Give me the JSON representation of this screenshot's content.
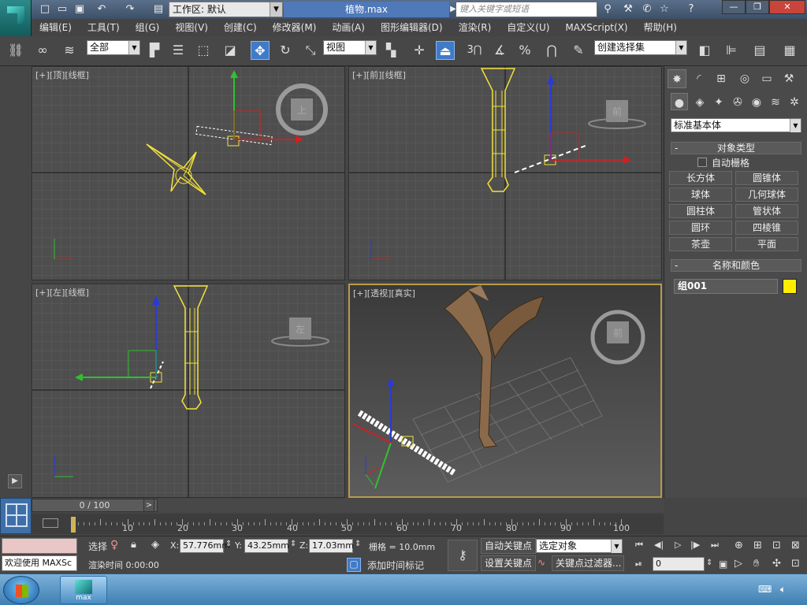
{
  "titlebar": {
    "workspace": "工作区: 默认",
    "filename": "植物.max",
    "search_placeholder": "键入关键字或短语"
  },
  "menu": [
    "编辑(E)",
    "工具(T)",
    "组(G)",
    "视图(V)",
    "创建(C)",
    "修改器(M)",
    "动画(A)",
    "图形编辑器(D)",
    "渲染(R)",
    "自定义(U)",
    "MAXScript(X)",
    "帮助(H)"
  ],
  "toolbar": {
    "selection_filter": "全部",
    "ref_coord": "视图",
    "named_selection": "创建选择集",
    "snap_label": "3"
  },
  "viewports": {
    "top": "[+][顶][线框]",
    "front": "[+][前][线框]",
    "left": "[+][左][线框]",
    "persp": "[+][透视][真实]"
  },
  "viewcube": {
    "top": "上",
    "front": "前",
    "left": "左",
    "persp": "前"
  },
  "cmdpanel": {
    "category": "标准基本体",
    "rollout_object_type": "对象类型",
    "autogrid": "自动栅格",
    "buttons": [
      "长方体",
      "圆锥体",
      "球体",
      "几何球体",
      "圆柱体",
      "管状体",
      "圆环",
      "四棱锥",
      "茶壶",
      "平面"
    ],
    "rollout_name_color": "名称和颜色",
    "object_name": "组001",
    "object_color": "#ffee00"
  },
  "timeline": {
    "slider_text": "0 / 100",
    "labels": [
      "10",
      "20",
      "30",
      "40",
      "50",
      "60",
      "70",
      "80",
      "90",
      "100"
    ]
  },
  "status": {
    "maxscript_listener": "欢迎使用 MAXSc",
    "select_label": "选择",
    "x_label": "X:",
    "x_value": "57.776mm",
    "y_label": "Y:",
    "y_value": "43.25mm",
    "z_label": "Z:",
    "z_value": "17.03mm",
    "grid": "栅格 = 10.0mm",
    "render_time": "渲染时间  0:00:00",
    "add_time_tag": "添加时间标记",
    "auto_key": "自动关键点",
    "set_key": "设置关键点",
    "key_mode": "选定对象",
    "key_filters": "关键点过滤器...",
    "frame": "0"
  },
  "taskbar": {
    "app_label": "max"
  }
}
